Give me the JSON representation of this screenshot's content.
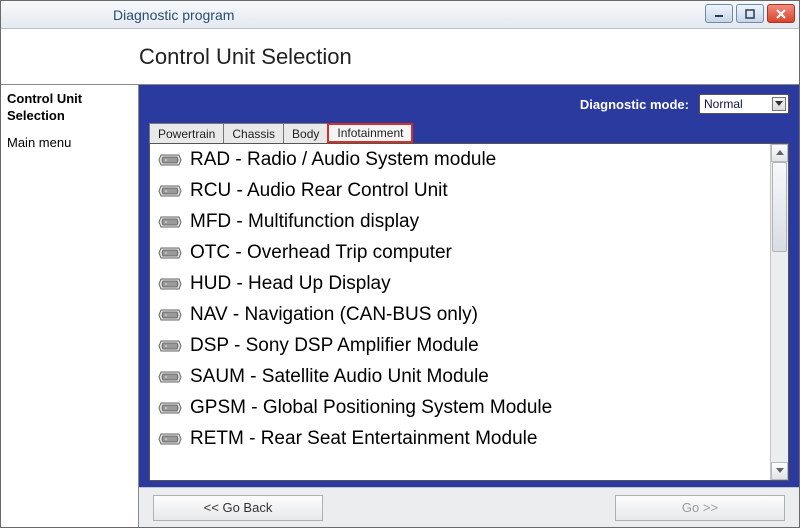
{
  "window": {
    "title": "Diagnostic program"
  },
  "page": {
    "title": "Control Unit Selection"
  },
  "sidebar": {
    "items": [
      {
        "label": "Control Unit Selection",
        "bold": true
      },
      {
        "label": "Main menu",
        "bold": false
      }
    ]
  },
  "mode": {
    "label": "Diagnostic mode:",
    "value": "Normal"
  },
  "tabs": [
    {
      "label": "Powertrain",
      "active": false
    },
    {
      "label": "Chassis",
      "active": false
    },
    {
      "label": "Body",
      "active": false
    },
    {
      "label": "Infotainment",
      "active": true
    }
  ],
  "modules": [
    "RAD - Radio / Audio System module",
    "RCU - Audio Rear Control Unit",
    "MFD - Multifunction display",
    "OTC - Overhead Trip computer",
    "HUD - Head Up Display",
    "NAV - Navigation (CAN-BUS only)",
    "DSP - Sony DSP Amplifier Module",
    "SAUM - Satellite Audio Unit Module",
    "GPSM - Global Positioning System Module",
    "RETM - Rear Seat Entertainment Module"
  ],
  "nav": {
    "back": "<< Go Back",
    "forward": "Go >>"
  }
}
